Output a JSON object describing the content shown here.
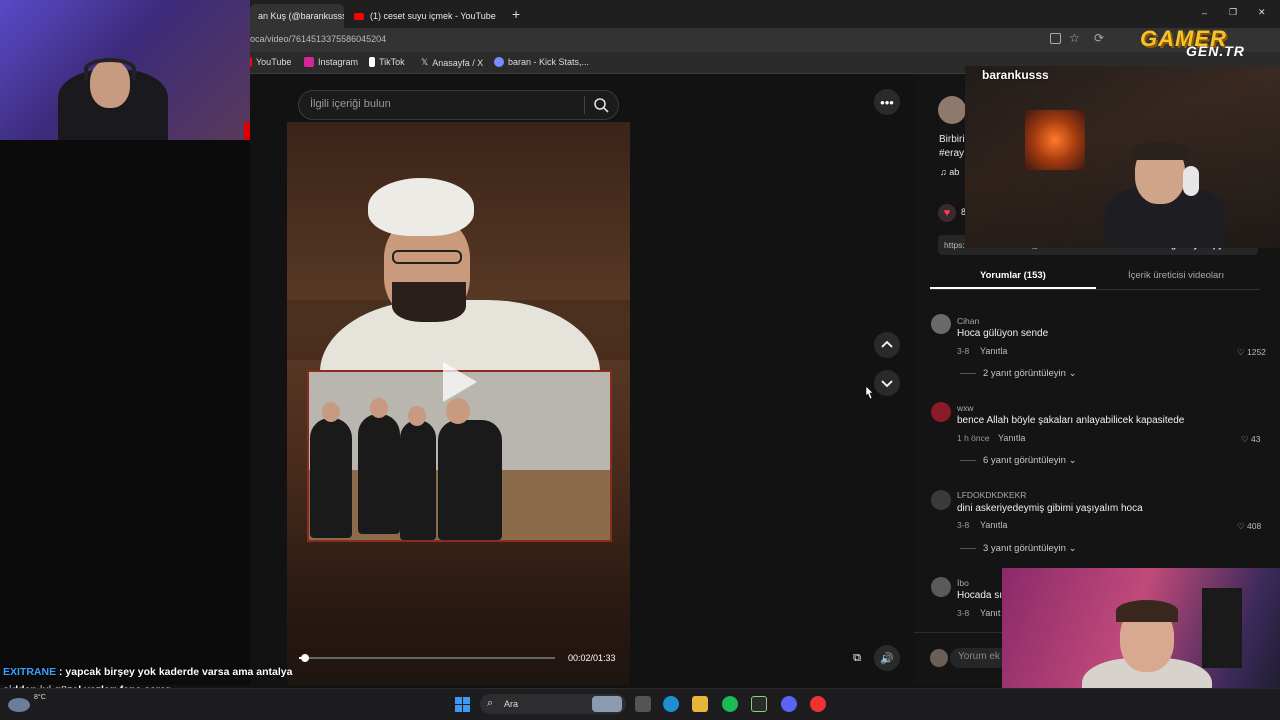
{
  "browser": {
    "tabs": [
      {
        "label": "an Kuş (@barankusss)",
        "active": true
      },
      {
        "label": "(1) ceset suyu içmek - YouTube",
        "active": false
      }
    ],
    "new_tab": "+",
    "url": "oca/video/7614513375586045204",
    "bookmarks": [
      {
        "label": "YouTube",
        "icon": "youtube-icon",
        "color": "#ff0000"
      },
      {
        "label": "Instagram",
        "icon": "instagram-icon",
        "color": "#d6249f"
      },
      {
        "label": "TikTok",
        "icon": "tiktok-icon",
        "color": "#ffffff"
      },
      {
        "label": "Anasayfa / X",
        "icon": "x-icon",
        "color": "#ffffff"
      },
      {
        "label": "baran - Kick Stats,...",
        "icon": "kick-stats-icon",
        "color": "#7a8cff"
      }
    ],
    "window_controls": [
      "–",
      "❐",
      "✕"
    ]
  },
  "search": {
    "placeholder": "İlgili içeriği bulun"
  },
  "video": {
    "time": "00:02/01:33",
    "progress": 0.02
  },
  "post": {
    "desc_line1": "Birbiri",
    "desc_line2": "#eray",
    "music": "♫  ab",
    "like_count": "8",
    "link": "https://www.tiktok.com/@abdullah.n.methoc...",
    "copy_label": "Bağlantıyı kopyala"
  },
  "tabs": {
    "comments": "Yorumlar (153)",
    "creator_videos": "İçerik üreticisi videoları"
  },
  "comments": [
    {
      "name": "Cihan",
      "text": "Hoca gülüyon sende",
      "date": "3-8",
      "reply": "Yanıtla",
      "likes": "1252",
      "more": "2 yanıt görüntüleyin",
      "avatar_color": "#6a6a6a"
    },
    {
      "name": "wxw",
      "text": "bence Allah böyle şakaları anlayabilicek kapasitede",
      "date": "1 h önce",
      "reply": "Yanıtla",
      "likes": "43",
      "more": "6 yanıt görüntüleyin",
      "avatar_color": "#8a1a2a"
    },
    {
      "name": "LFDOKDKDKEKR",
      "text": "dini askeriyedeymiş gibimi yaşıyalım hoca",
      "date": "3-8",
      "reply": "Yanıtla",
      "likes": "408",
      "more": "3 yanıt görüntüleyin",
      "avatar_color": "#3a3a3a"
    },
    {
      "name": "İbo",
      "text": "Hocada sı",
      "date": "3-8",
      "reply": "Yanıt",
      "likes": "",
      "more": "",
      "avatar_color": "#5a5a5a"
    }
  ],
  "comment_input": {
    "placeholder": "Yorum ek"
  },
  "overlay": {
    "cam_name": "barankusss",
    "logo_top": "GAMER",
    "logo_bottom": "GEN.TR"
  },
  "chat": {
    "user": "EXITRANE",
    "line1_rest": " : yapcak birşey yok kaderde varsa ama antalya",
    "line2": "cidden iyi güzel yazları fena sarar"
  },
  "taskbar": {
    "search_label": "Ara",
    "temp": "8°C"
  }
}
